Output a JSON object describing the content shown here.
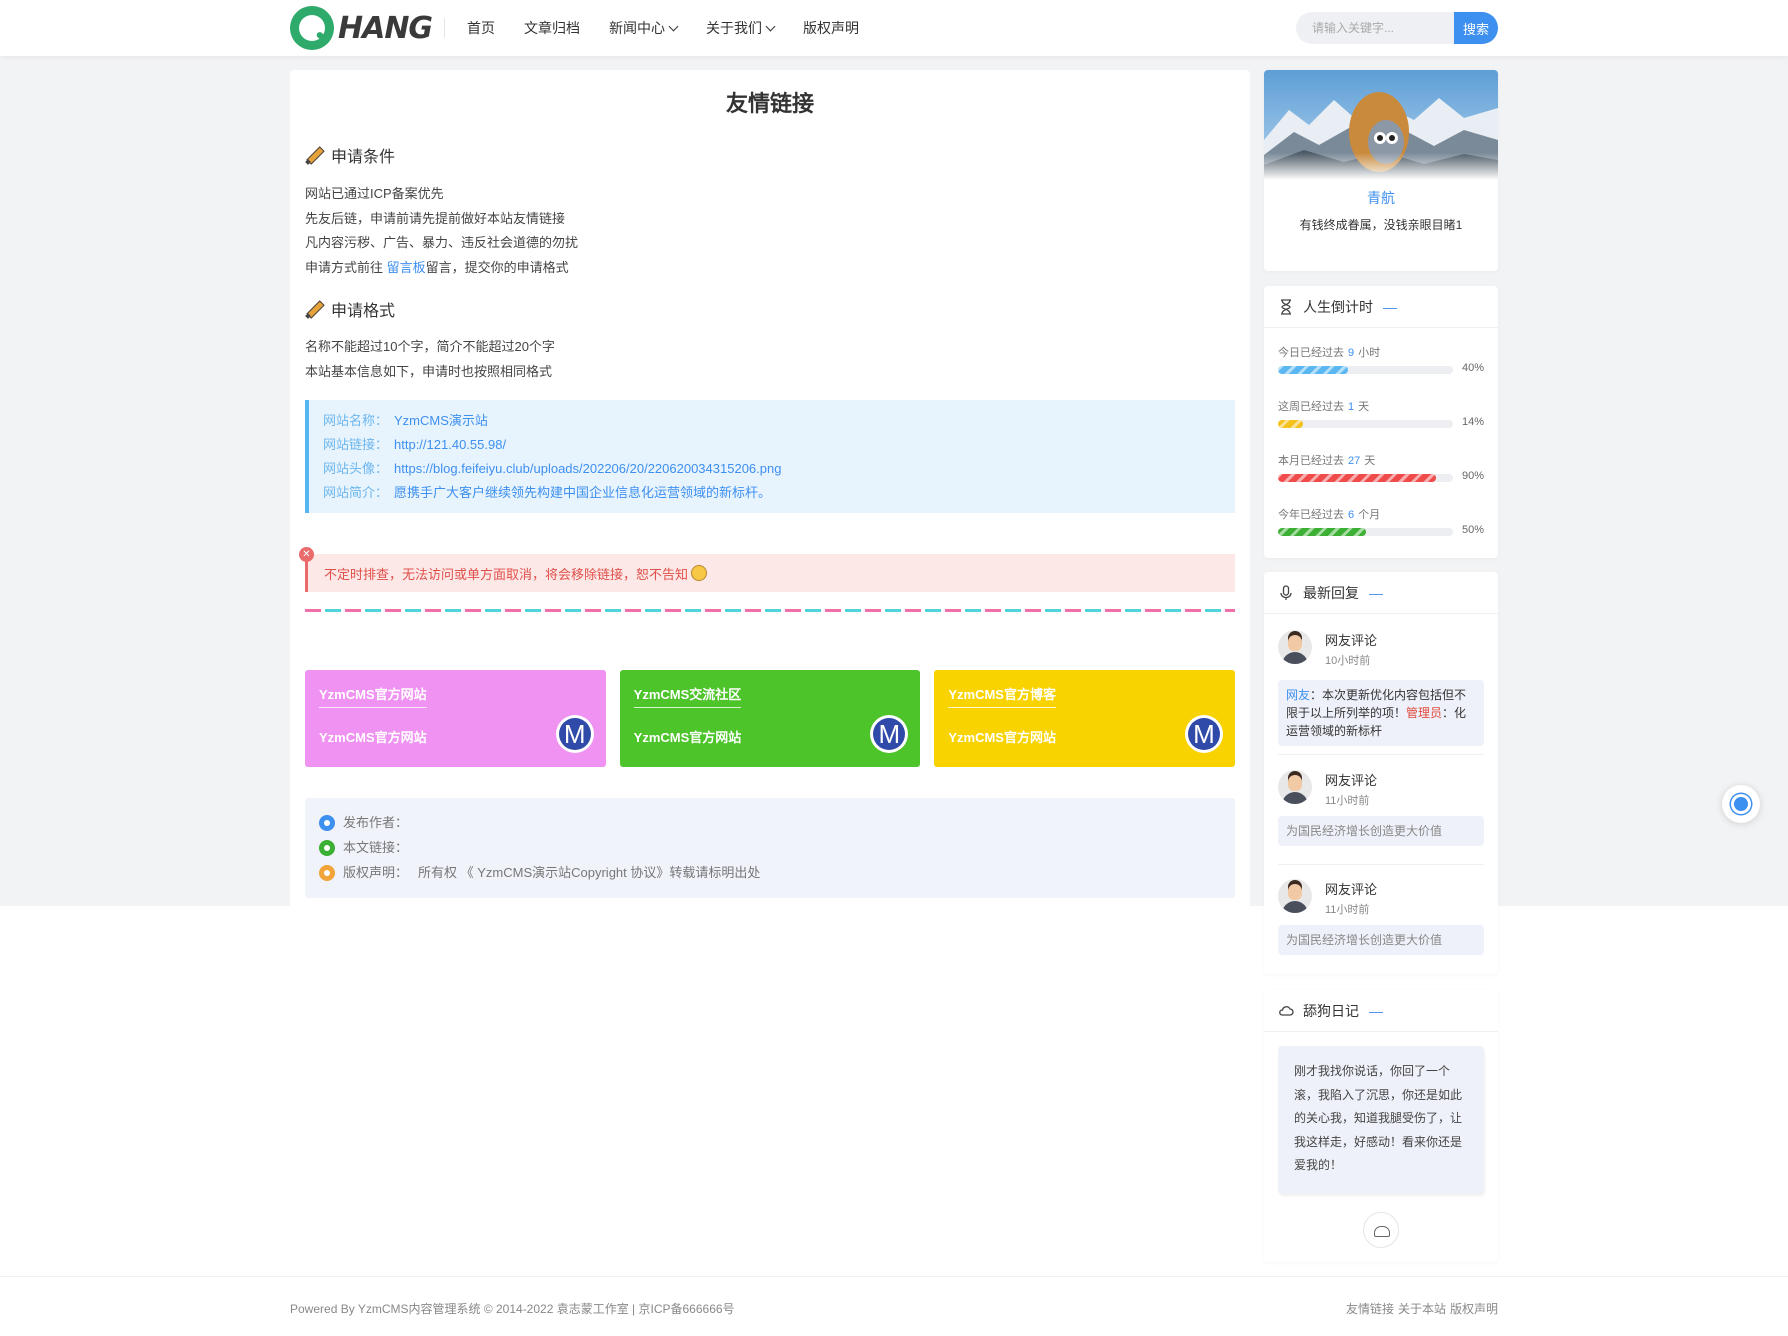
{
  "header": {
    "logo_text": "HANG",
    "nav": [
      {
        "label": "首页",
        "dropdown": false
      },
      {
        "label": "文章归档",
        "dropdown": false
      },
      {
        "label": "新闻中心",
        "dropdown": true
      },
      {
        "label": "关于我们",
        "dropdown": true
      },
      {
        "label": "版权声明",
        "dropdown": false
      }
    ],
    "search_placeholder": "请输入关键字...",
    "search_button": "搜索"
  },
  "main": {
    "title": "友情链接",
    "section1": {
      "heading": "申请条件",
      "lines": [
        "网站已通过ICP备案优先",
        "先友后链，申请前请先提前做好本站友情链接",
        "凡内容污秽、广告、暴力、违反社会道德的勿扰"
      ],
      "last_prefix": "申请方式前往 ",
      "last_link": "留言板",
      "last_suffix": "留言，提交你的申请格式"
    },
    "section2": {
      "heading": "申请格式",
      "lines": [
        "名称不能超过10个字，简介不能超过20个字",
        "本站基本信息如下，申请时也按照相同格式"
      ]
    },
    "info": [
      {
        "key": "网站名称：",
        "value": "YzmCMS演示站"
      },
      {
        "key": "网站链接：",
        "value": "http://121.40.55.98/"
      },
      {
        "key": "网站头像：",
        "value": "https://blog.feifeiyu.club/uploads/202206/20/220620034315206.png"
      },
      {
        "key": "网站简介：",
        "value": "愿携手广大客户继续领先构建中国企业信息化运营领域的新标杆。"
      }
    ],
    "warning": "不定时排查，无法访问或单方面取消，将会移除链接，恕不告知",
    "link_cards": [
      {
        "name": "YzmCMS官方网站",
        "desc": "YzmCMS官方网站",
        "color": "#ef92f2",
        "logo": "M"
      },
      {
        "name": "YzmCMS交流社区",
        "desc": "YzmCMS官方网站",
        "color": "#4cc42a",
        "logo": "M"
      },
      {
        "name": "YzmCMS官方博客",
        "desc": "YzmCMS官方网站",
        "color": "#f9d300",
        "logo": "M"
      }
    ],
    "meta": {
      "author_label": "发布作者：",
      "link_label": "本文链接：",
      "copyright_label": "版权声明：",
      "copyright_text": "所有权 《 YzmCMS演示站Copyright 协议》转载请标明出处"
    }
  },
  "sidebar": {
    "profile": {
      "name": "青航",
      "bio": "有钱终成眷属，没钱亲眼目睹1"
    },
    "countdown": {
      "title": "人生倒计时",
      "items": [
        {
          "prefix": "今日已经过去",
          "value": "9",
          "unit": "小时",
          "percent": 40,
          "percent_label": "40%",
          "color": "#5ab7f2"
        },
        {
          "prefix": "这周已经过去",
          "value": "1",
          "unit": "天",
          "percent": 14,
          "percent_label": "14%",
          "color": "#f5c21b"
        },
        {
          "prefix": "本月已经过去",
          "value": "27",
          "unit": "天",
          "percent": 90,
          "percent_label": "90%",
          "color": "#ef4b4b"
        },
        {
          "prefix": "今年已经过去",
          "value": "6",
          "unit": "个月",
          "percent": 50,
          "percent_label": "50%",
          "color": "#3cb034"
        }
      ]
    },
    "replies": {
      "title": "最新回复",
      "items": [
        {
          "name": "网友评论",
          "time": "10小时前"
        },
        {
          "name": "网友评论",
          "time": "11小时前",
          "body": "为国民经济增长创造更大价值"
        },
        {
          "name": "网友评论",
          "time": "11小时前",
          "body": "为国民经济增长创造更大价值"
        }
      ],
      "first_body": {
        "u1": "网友",
        "t1": "：本次更新优化内容包括但不限于以上所列举的项！",
        "u2": "管理员",
        "t2": "：化运营领域的新标杆"
      }
    },
    "diary": {
      "title": "舔狗日记",
      "text": "刚才我找你说话，你回了一个滚，我陷入了沉思，你还是如此的关心我，知道我腿受伤了，让我这样走，好感动！看来你还是爱我的！"
    }
  },
  "footer": {
    "left": "Powered By YzmCMS内容管理系统 © 2014-2022 袁志蒙工作室 | 京ICP备666666号",
    "links": [
      "友情链接",
      "关于本站",
      "版权声明"
    ]
  }
}
